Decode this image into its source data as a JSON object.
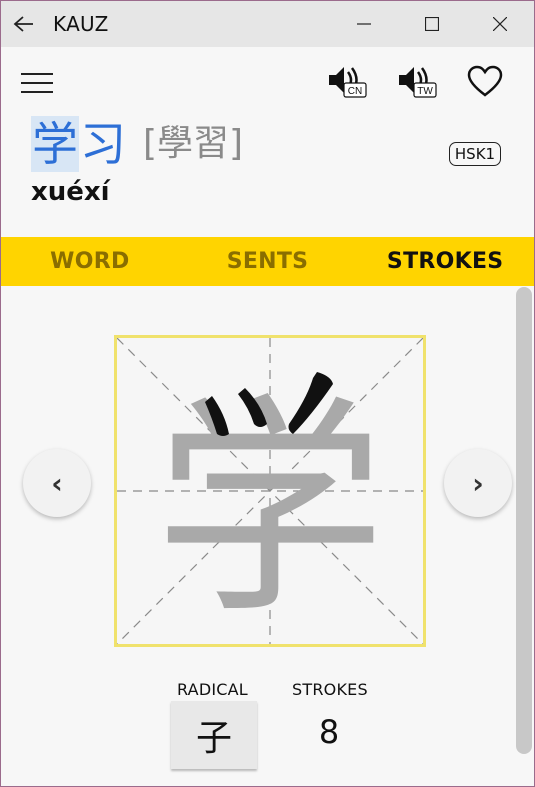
{
  "window": {
    "title": "KAUZ",
    "back_icon": "arrow-left-icon",
    "minimize_icon": "minimize-icon",
    "maximize_icon": "maximize-icon",
    "close_icon": "close-icon"
  },
  "header": {
    "menu_icon": "hamburger-icon",
    "speaker_cn_label": "CN",
    "speaker_tw_label": "TW",
    "favorite_icon": "heart-icon"
  },
  "word": {
    "simplified_chars": [
      "学",
      "习"
    ],
    "traditional": "[學習]",
    "pinyin": "xuéxí",
    "hsk": "HSK1"
  },
  "tabs": [
    {
      "label": "WORD",
      "active": false
    },
    {
      "label": "SENTS",
      "active": false
    },
    {
      "label": "STROKES",
      "active": true
    }
  ],
  "strokes": {
    "character": "学",
    "prev_label": "‹",
    "next_label": "›",
    "radical_label": "RADICAL",
    "radical": "子",
    "strokes_label": "STROKES",
    "stroke_count": "8"
  },
  "colors": {
    "accent_yellow": "#ffd400",
    "hanzi_blue": "#2d6fd6",
    "box_border": "#f0e26c"
  }
}
